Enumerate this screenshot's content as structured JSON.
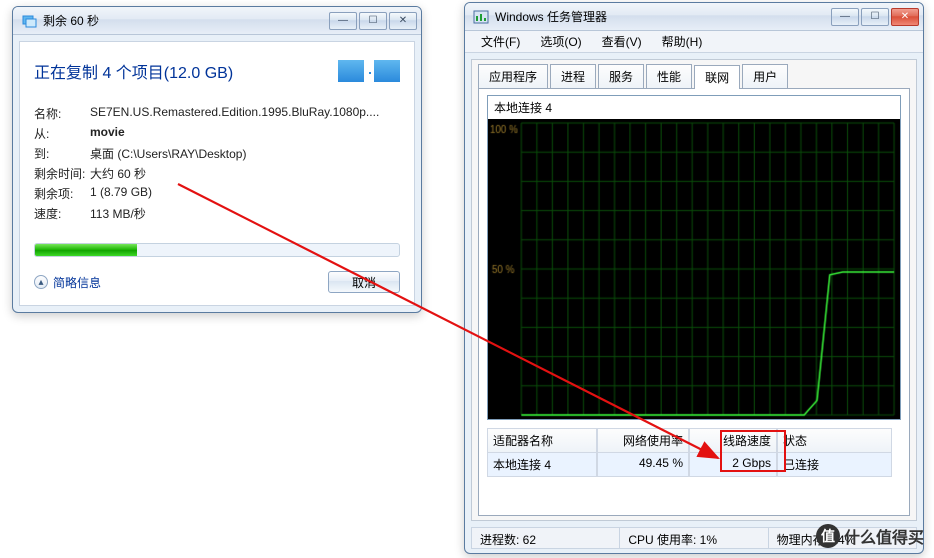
{
  "copy_dialog": {
    "window_title": "剩余 60 秒",
    "header": "正在复制 4 个项目(12.0 GB)",
    "fields": {
      "name_label": "名称:",
      "name_value": "SE7EN.US.Remastered.Edition.1995.BluRay.1080p....",
      "from_label": "从:",
      "from_value": "movie",
      "to_label": "到:",
      "to_value": "桌面 (C:\\Users\\RAY\\Desktop)",
      "time_left_label": "剩余时间:",
      "time_left_value": "大约 60 秒",
      "items_left_label": "剩余项:",
      "items_left_value": "1 (8.79 GB)",
      "speed_label": "速度:",
      "speed_value": "113 MB/秒"
    },
    "progress_pct": 28,
    "expand_label": "简略信息",
    "cancel_label": "取消"
  },
  "task_manager": {
    "window_title": "Windows 任务管理器",
    "menu": [
      "文件(F)",
      "选项(O)",
      "查看(V)",
      "帮助(H)"
    ],
    "tabs": [
      "应用程序",
      "进程",
      "服务",
      "性能",
      "联网",
      "用户"
    ],
    "active_tab_index": 4,
    "graph_title": "本地连接 4",
    "graph_y_labels": [
      "100 %",
      "50 %"
    ],
    "table_headers": [
      "适配器名称",
      "网络使用率",
      "线路速度",
      "状态"
    ],
    "table_row": [
      "本地连接 4",
      "49.45 %",
      "2 Gbps",
      "已连接"
    ],
    "status": {
      "processes_label": "进程数: 62",
      "cpu_label": "CPU 使用率: 1%",
      "mem_label": "物理内存: 24%"
    }
  },
  "chart_data": {
    "type": "line",
    "title": "本地连接 4",
    "ylabel": "%",
    "ylim": [
      0,
      100
    ],
    "x": [
      0,
      1,
      2,
      3,
      4,
      5,
      6,
      7,
      8,
      9,
      10,
      11,
      12,
      13,
      14,
      15,
      16,
      17,
      18,
      19,
      20,
      21,
      22,
      23,
      24,
      25,
      26,
      27,
      28,
      29
    ],
    "series": [
      {
        "name": "网络使用率",
        "values": [
          0,
          0,
          0,
          0,
          0,
          0,
          0,
          0,
          0,
          0,
          0,
          0,
          0,
          0,
          0,
          0,
          0,
          0,
          0,
          0,
          0,
          0,
          0,
          5,
          48,
          49,
          49,
          49,
          49,
          49
        ]
      }
    ]
  },
  "watermark": "什么值得买"
}
